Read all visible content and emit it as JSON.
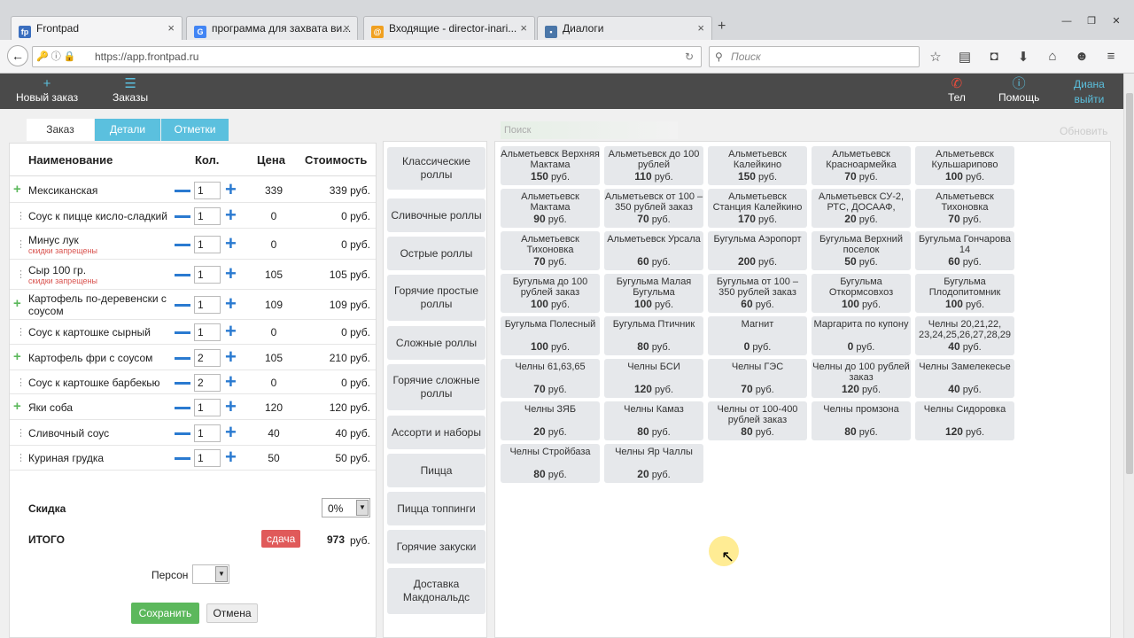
{
  "browser": {
    "tabs": [
      {
        "title": "Frontpad",
        "icon": "fp",
        "color": "#3b6fbf",
        "active": true
      },
      {
        "title": "программа для захвата ви...",
        "icon": "G",
        "color": "#4285f4"
      },
      {
        "title": "Входящие - director-inari...",
        "icon": "@",
        "color": "#f0a020"
      },
      {
        "title": "Диалоги",
        "icon": "chat",
        "color": "#4a76a8"
      }
    ],
    "new_tab": "+",
    "url": "https://app.frontpad.ru",
    "search_placeholder": "Поиск"
  },
  "appbar": {
    "new_order": "Новый заказ",
    "orders": "Заказы",
    "tel": "Тел",
    "help": "Помощь",
    "user": "Диана",
    "logout": "выйти"
  },
  "order": {
    "tabs": [
      "Заказ",
      "Детали",
      "Отметки"
    ],
    "headers": {
      "name": "Наименование",
      "qty": "Кол.",
      "price": "Цена",
      "cost": "Стоимость"
    },
    "items": [
      {
        "name": "Мексиканская",
        "qty": "1",
        "price": "339",
        "cost": "339 руб.",
        "warn": "",
        "root": true
      },
      {
        "name": "Соус к пицце кисло-сладкий",
        "qty": "1",
        "price": "0",
        "cost": "0 руб.",
        "warn": "",
        "root": false
      },
      {
        "name": "Минус лук",
        "qty": "1",
        "price": "0",
        "cost": "0 руб.",
        "warn": "скидки запрещены",
        "root": false
      },
      {
        "name": "Сыр 100 гр.",
        "qty": "1",
        "price": "105",
        "cost": "105 руб.",
        "warn": "скидки запрещены",
        "root": false
      },
      {
        "name": "Картофель по-деревенски с соусом",
        "qty": "1",
        "price": "109",
        "cost": "109 руб.",
        "warn": "",
        "root": true
      },
      {
        "name": "Соус к картошке сырный",
        "qty": "1",
        "price": "0",
        "cost": "0 руб.",
        "warn": "",
        "root": false
      },
      {
        "name": "Картофель фри с соусом",
        "qty": "2",
        "price": "105",
        "cost": "210 руб.",
        "warn": "",
        "root": true
      },
      {
        "name": "Соус к картошке барбекью",
        "qty": "2",
        "price": "0",
        "cost": "0 руб.",
        "warn": "",
        "root": false
      },
      {
        "name": "Яки соба",
        "qty": "1",
        "price": "120",
        "cost": "120 руб.",
        "warn": "",
        "root": true
      },
      {
        "name": "Сливочный соус",
        "qty": "1",
        "price": "40",
        "cost": "40 руб.",
        "warn": "",
        "root": false
      },
      {
        "name": "Куриная грудка",
        "qty": "1",
        "price": "50",
        "cost": "50 руб.",
        "warn": "",
        "root": false
      }
    ],
    "discount_label": "Скидка",
    "discount_value": "0%",
    "total_label": "ИТОГО",
    "change_label": "сдача",
    "total_value": "973",
    "total_unit": "руб.",
    "persons_label": "Персон",
    "save": "Сохранить",
    "cancel": "Отмена"
  },
  "categories": [
    "Классические роллы",
    "Сливочные роллы",
    "Острые роллы",
    "Горячие простые роллы",
    "Сложные роллы",
    "Горячие сложные роллы",
    "Ассорти и наборы",
    "Пицца",
    "Пицца топпинги",
    "Горячие закуски",
    "Доставка Макдональдс"
  ],
  "products": {
    "search_placeholder": "Поиск",
    "refresh": "Обновить",
    "unit": "руб.",
    "items": [
      {
        "name": "Альметьевск Верхняя Мактама",
        "price": "150"
      },
      {
        "name": "Альметьевск до 100 рублей",
        "price": "110"
      },
      {
        "name": "Альметьевск Калейкино",
        "price": "150"
      },
      {
        "name": "Альметьевск Красноармейка",
        "price": "70"
      },
      {
        "name": "Альметьевск Кульшарипово",
        "price": "100"
      },
      {
        "name": "Альметьевск Мактама",
        "price": "90"
      },
      {
        "name": "Альметьевск от 100 – 350 рублей заказ",
        "price": "70"
      },
      {
        "name": "Альметьевск Станция Калейкино",
        "price": "170"
      },
      {
        "name": "Альметьевск СУ-2, РТС, ДОСААФ,",
        "price": "20"
      },
      {
        "name": "Альметьевск Тихоновка",
        "price": "70"
      },
      {
        "name": "Альметьевск Тихоновка",
        "price": "70"
      },
      {
        "name": "Альметьевск Урсала",
        "price": "60"
      },
      {
        "name": "Бугульма Аэропорт",
        "price": "200"
      },
      {
        "name": "Бугульма Верхний поселок",
        "price": "50"
      },
      {
        "name": "Бугульма Гончарова 14",
        "price": "60"
      },
      {
        "name": "Бугульма до 100 рублей заказ",
        "price": "100"
      },
      {
        "name": "Бугульма Малая Бугульма",
        "price": "100"
      },
      {
        "name": "Бугульма от 100 – 350 рублей заказ",
        "price": "60"
      },
      {
        "name": "Бугульма Откормсовхоз",
        "price": "100"
      },
      {
        "name": "Бугульма Плодопитомник",
        "price": "100"
      },
      {
        "name": "Бугульма Полесный",
        "price": "100"
      },
      {
        "name": "Бугульма Птичник",
        "price": "80"
      },
      {
        "name": "Магнит",
        "price": "0"
      },
      {
        "name": "Маргарита по купону",
        "price": "0"
      },
      {
        "name": "Челны 20,21,22, 23,24,25,26,27,28,29",
        "price": "40"
      },
      {
        "name": "Челны 61,63,65",
        "price": "70"
      },
      {
        "name": "Челны БСИ",
        "price": "120"
      },
      {
        "name": "Челны ГЭС",
        "price": "70"
      },
      {
        "name": "Челны до 100 рублей заказ",
        "price": "120"
      },
      {
        "name": "Челны Замелекесье",
        "price": "40"
      },
      {
        "name": "Челны ЗЯБ",
        "price": "20"
      },
      {
        "name": "Челны Камаз",
        "price": "80"
      },
      {
        "name": "Челны от 100-400 рублей заказ",
        "price": "80"
      },
      {
        "name": "Челны промзона",
        "price": "80"
      },
      {
        "name": "Челны Сидоровка",
        "price": "120"
      },
      {
        "name": "Челны Стройбаза",
        "price": "80"
      },
      {
        "name": "Челны Яр Чаллы",
        "price": "20"
      }
    ]
  }
}
